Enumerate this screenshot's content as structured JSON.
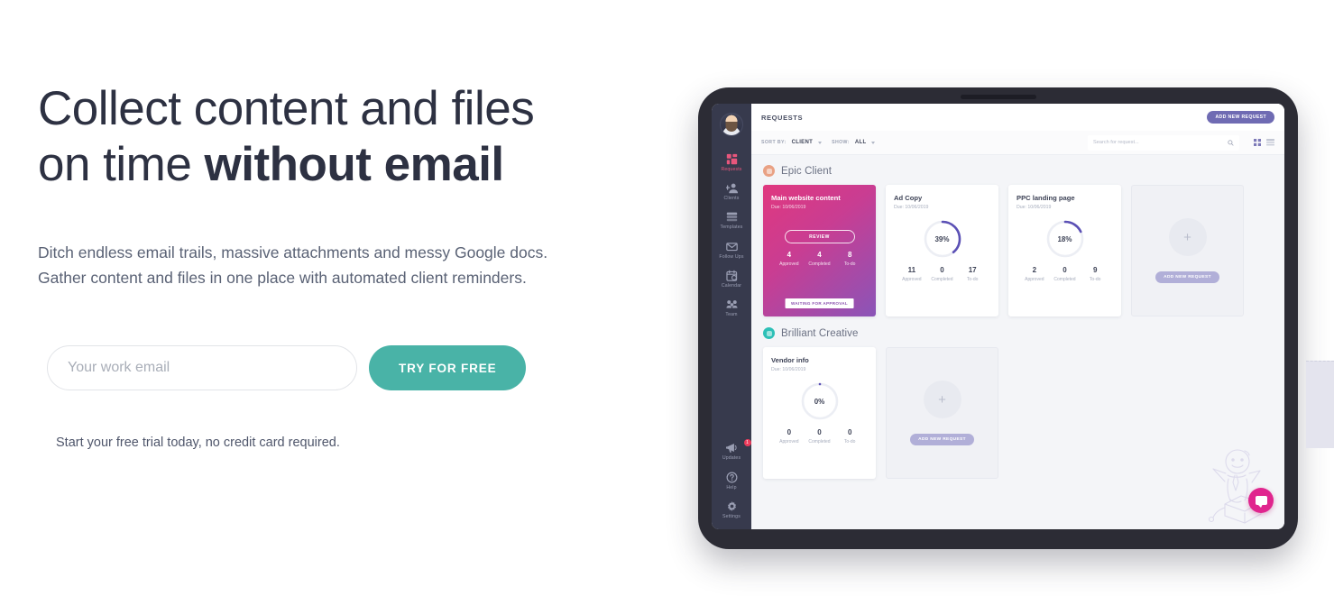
{
  "hero": {
    "title_line1": "Collect content and files",
    "title_line2_normal": "on time ",
    "title_line2_strong": "without email",
    "subtitle_line1": "Ditch endless email trails, massive attachments and messy Google docs.",
    "subtitle_line2": "Gather content and files in one place with automated client reminders.",
    "email_placeholder": "Your work email",
    "email_value": "",
    "cta_label": "TRY FOR FREE",
    "note": "Start your free trial today, no credit card required.",
    "accent_color": "#49b3a7",
    "title_color": "#2d3142"
  },
  "app": {
    "sidebar": {
      "avatar_name": "user-avatar",
      "items": [
        {
          "label": "Requests",
          "icon": "grid-icon",
          "active": true
        },
        {
          "label": "Clients",
          "icon": "add-user-icon",
          "active": false
        },
        {
          "label": "Templates",
          "icon": "layers-icon",
          "active": false
        },
        {
          "label": "Follow Ups",
          "icon": "envelope-icon",
          "active": false
        },
        {
          "label": "Calendar",
          "icon": "calendar-icon",
          "active": false
        },
        {
          "label": "Team",
          "icon": "team-icon",
          "active": false
        }
      ],
      "bottom_items": [
        {
          "label": "Updates",
          "icon": "megaphone-icon",
          "badge": "1"
        },
        {
          "label": "Help",
          "icon": "question-icon",
          "badge": ""
        },
        {
          "label": "Settings",
          "icon": "gear-icon",
          "badge": ""
        }
      ],
      "active_color": "#e8567c",
      "bg_color": "#373a4d"
    },
    "topbar": {
      "title": "REQUESTS",
      "add_request_label": "ADD NEW REQUEST",
      "add_request_color": "#6f6bb3"
    },
    "toolbar": {
      "sort_label": "SORT BY:",
      "sort_value": "CLIENT",
      "show_label": "SHOW:",
      "show_value": "ALL",
      "search_placeholder": "Search for request...",
      "search_value": "",
      "grid_view_icon": "grid-view-icon",
      "list_view_icon": "list-view-icon"
    },
    "groups": [
      {
        "name": "Epic Client",
        "dot_color": "#e9a184",
        "cards": [
          {
            "type": "featured",
            "title": "Main website content",
            "due": "Due: 10/06/2019",
            "action_label": "REVIEW",
            "status": "WAITING FOR APPROVAL",
            "stats": [
              {
                "num": "4",
                "label": "Approved"
              },
              {
                "num": "4",
                "label": "Completed"
              },
              {
                "num": "8",
                "label": "To-do"
              }
            ]
          },
          {
            "type": "progress",
            "title": "Ad Copy",
            "due": "Due: 10/06/2019",
            "percent": 39,
            "percent_label": "39%",
            "stats": [
              {
                "num": "11",
                "label": "Approved"
              },
              {
                "num": "0",
                "label": "Completed"
              },
              {
                "num": "17",
                "label": "To-do"
              }
            ]
          },
          {
            "type": "progress",
            "title": "PPC landing page",
            "due": "Due: 10/06/2019",
            "percent": 18,
            "percent_label": "18%",
            "stats": [
              {
                "num": "2",
                "label": "Approved"
              },
              {
                "num": "0",
                "label": "Completed"
              },
              {
                "num": "9",
                "label": "To-do"
              }
            ]
          },
          {
            "type": "ghost",
            "plus": "+",
            "button_label": "ADD NEW REQUEST"
          }
        ]
      },
      {
        "name": "Brilliant Creative",
        "dot_color": "#2dc0b7",
        "cards": [
          {
            "type": "progress",
            "title": "Vendor info",
            "due": "Due: 10/06/2019",
            "percent": 0,
            "percent_label": "0%",
            "stats": [
              {
                "num": "0",
                "label": "Approved"
              },
              {
                "num": "0",
                "label": "Completed"
              },
              {
                "num": "0",
                "label": "To-do"
              }
            ]
          },
          {
            "type": "ghost",
            "plus": "+",
            "button_label": "ADD NEW REQUEST"
          }
        ]
      }
    ],
    "chat_fab": {
      "name": "chat-bubble",
      "color": "#e0258e"
    },
    "doodle": {
      "name": "person-on-box-illustration"
    }
  }
}
